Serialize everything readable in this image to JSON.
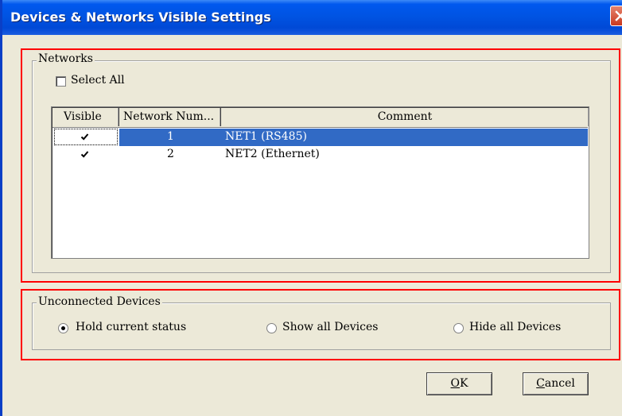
{
  "window": {
    "title": "Devices & Networks Visible Settings"
  },
  "networks": {
    "legend": "Networks",
    "select_all_label": "Select All",
    "select_all_checked": false,
    "columns": [
      "Visible",
      "Network Num...",
      "Comment"
    ],
    "rows": [
      {
        "visible": true,
        "number": "1",
        "comment": "NET1 (RS485)",
        "selected": true
      },
      {
        "visible": true,
        "number": "2",
        "comment": "NET2 (Ethernet)",
        "selected": false
      }
    ]
  },
  "unconnected": {
    "legend": "Unconnected Devices",
    "options": [
      "Hold current status",
      "Show all Devices",
      "Hide all Devices"
    ],
    "selected_index": 0
  },
  "buttons": {
    "ok_mnemonic": "O",
    "ok_rest": "K",
    "cancel_mnemonic": "C",
    "cancel_rest": "ancel"
  },
  "colors": {
    "titlebar": "#0054e3",
    "selection": "#316ac5",
    "highlight_box": "#ff0000",
    "dialog_bg": "#ece9d8"
  }
}
